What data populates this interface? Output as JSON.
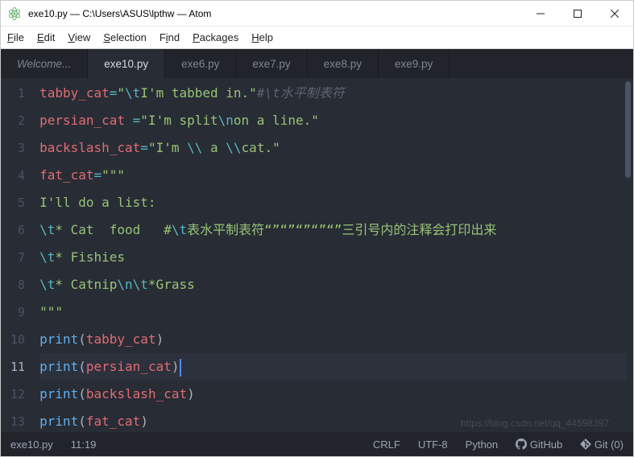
{
  "window": {
    "title": "exe10.py — C:\\Users\\ASUS\\lpthw — Atom"
  },
  "menu": {
    "file": "File",
    "edit": "Edit",
    "view": "View",
    "selection": "Selection",
    "find": "Find",
    "packages": "Packages",
    "help": "Help"
  },
  "tabs": {
    "welcome": "Welcome...",
    "exe10": "exe10.py",
    "exe6": "exe6.py",
    "exe7": "exe7.py",
    "exe8": "exe8.py",
    "exe9": "exe9.py"
  },
  "code": {
    "lines": [
      {
        "n": "1",
        "seg": [
          {
            "c": "tk-var",
            "t": "tabby_cat"
          },
          {
            "c": "tk-op",
            "t": "="
          },
          {
            "c": "tk-str",
            "t": "\""
          },
          {
            "c": "tk-esc",
            "t": "\\t"
          },
          {
            "c": "tk-str",
            "t": "I'm tabbed in.\""
          },
          {
            "c": "tk-com",
            "t": "#\\t水平制表符"
          }
        ]
      },
      {
        "n": "2",
        "seg": [
          {
            "c": "tk-var",
            "t": "persian_cat "
          },
          {
            "c": "tk-op",
            "t": "="
          },
          {
            "c": "tk-str",
            "t": "\"I'm split"
          },
          {
            "c": "tk-esc",
            "t": "\\n"
          },
          {
            "c": "tk-str",
            "t": "on a line.\""
          }
        ]
      },
      {
        "n": "3",
        "seg": [
          {
            "c": "tk-var",
            "t": "backslash_cat"
          },
          {
            "c": "tk-op",
            "t": "="
          },
          {
            "c": "tk-str",
            "t": "\"I'm "
          },
          {
            "c": "tk-esc",
            "t": "\\\\"
          },
          {
            "c": "tk-str",
            "t": " a "
          },
          {
            "c": "tk-esc",
            "t": "\\\\"
          },
          {
            "c": "tk-str",
            "t": "cat.\""
          }
        ]
      },
      {
        "n": "4",
        "seg": [
          {
            "c": "tk-var",
            "t": "fat_cat"
          },
          {
            "c": "tk-op",
            "t": "="
          },
          {
            "c": "tk-str",
            "t": "\"\"\""
          }
        ]
      },
      {
        "n": "5",
        "seg": [
          {
            "c": "tk-str",
            "t": "I'll do a list:"
          }
        ]
      },
      {
        "n": "6",
        "seg": [
          {
            "c": "tk-esc",
            "t": "\\t"
          },
          {
            "c": "tk-str",
            "t": "* Cat  food   #"
          },
          {
            "c": "tk-esc",
            "t": "\\t"
          },
          {
            "c": "tk-str",
            "t": "表水平制表符“”“”“”“”“”三引号内的注释会打印出来"
          }
        ]
      },
      {
        "n": "7",
        "seg": [
          {
            "c": "tk-esc",
            "t": "\\t"
          },
          {
            "c": "tk-str",
            "t": "* Fishies"
          }
        ]
      },
      {
        "n": "8",
        "seg": [
          {
            "c": "tk-esc",
            "t": "\\t"
          },
          {
            "c": "tk-str",
            "t": "* Catnip"
          },
          {
            "c": "tk-esc",
            "t": "\\n\\t"
          },
          {
            "c": "tk-str",
            "t": "*Grass"
          }
        ]
      },
      {
        "n": "9",
        "seg": [
          {
            "c": "tk-str",
            "t": "\"\"\""
          }
        ]
      },
      {
        "n": "10",
        "seg": [
          {
            "c": "tk-fn",
            "t": "print"
          },
          {
            "c": "tk-punc",
            "t": "("
          },
          {
            "c": "tk-var",
            "t": "tabby_cat"
          },
          {
            "c": "tk-punc",
            "t": ")"
          }
        ]
      },
      {
        "n": "11",
        "hl": true,
        "cursor": true,
        "seg": [
          {
            "c": "tk-fn",
            "t": "print"
          },
          {
            "c": "tk-punc",
            "t": "("
          },
          {
            "c": "tk-var",
            "t": "persian_cat"
          },
          {
            "c": "tk-punc",
            "t": ")"
          }
        ]
      },
      {
        "n": "12",
        "seg": [
          {
            "c": "tk-fn",
            "t": "print"
          },
          {
            "c": "tk-punc",
            "t": "("
          },
          {
            "c": "tk-var",
            "t": "backslash_cat"
          },
          {
            "c": "tk-punc",
            "t": ")"
          }
        ]
      },
      {
        "n": "13",
        "seg": [
          {
            "c": "tk-fn",
            "t": "print"
          },
          {
            "c": "tk-punc",
            "t": "("
          },
          {
            "c": "tk-var",
            "t": "fat_cat"
          },
          {
            "c": "tk-punc",
            "t": ")"
          }
        ]
      }
    ]
  },
  "status": {
    "file": "exe10.py",
    "pos": "11:19",
    "eol": "CRLF",
    "enc": "UTF-8",
    "lang": "Python",
    "github": "GitHub",
    "git": "Git (0)"
  },
  "watermark": "https://blog.csdn.net/qq_44598397"
}
